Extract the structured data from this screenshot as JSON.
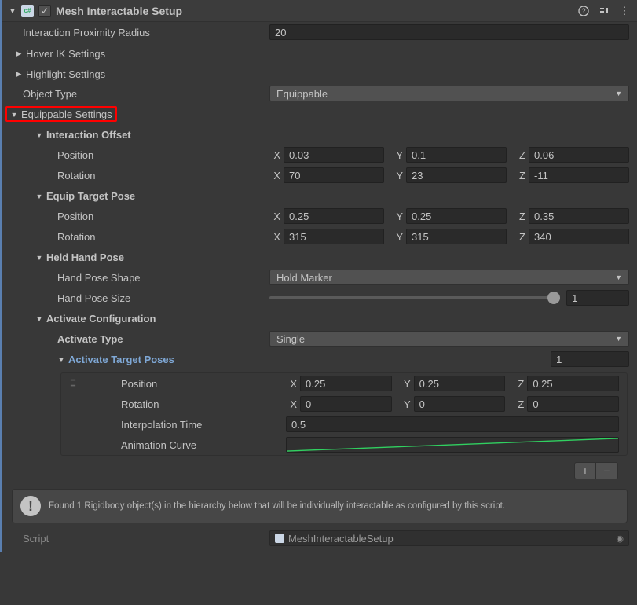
{
  "header": {
    "title": "Mesh Interactable Setup",
    "checked": true
  },
  "proximity": {
    "label": "Interaction Proximity Radius",
    "value": "20"
  },
  "hoverIK": {
    "label": "Hover IK Settings"
  },
  "highlight": {
    "label": "Highlight Settings"
  },
  "objectType": {
    "label": "Object Type",
    "value": "Equippable"
  },
  "equippable": {
    "label": "Equippable Settings",
    "interactionOffset": {
      "label": "Interaction Offset",
      "position": {
        "label": "Position",
        "x": "0.03",
        "y": "0.1",
        "z": "0.06"
      },
      "rotation": {
        "label": "Rotation",
        "x": "70",
        "y": "23",
        "z": "-11"
      }
    },
    "equipTargetPose": {
      "label": "Equip Target Pose",
      "position": {
        "label": "Position",
        "x": "0.25",
        "y": "0.25",
        "z": "0.35"
      },
      "rotation": {
        "label": "Rotation",
        "x": "315",
        "y": "315",
        "z": "340"
      }
    },
    "heldHandPose": {
      "label": "Held Hand Pose",
      "shape": {
        "label": "Hand Pose Shape",
        "value": "Hold Marker"
      },
      "size": {
        "label": "Hand Pose Size",
        "value": "1"
      }
    },
    "activateConfig": {
      "label": "Activate Configuration",
      "activateType": {
        "label": "Activate Type",
        "value": "Single"
      },
      "activateTargetPoses": {
        "label": "Activate Target Poses",
        "count": "1",
        "item0": {
          "position": {
            "label": "Position",
            "x": "0.25",
            "y": "0.25",
            "z": "0.25"
          },
          "rotation": {
            "label": "Rotation",
            "x": "0",
            "y": "0",
            "z": "0"
          },
          "interpTime": {
            "label": "Interpolation Time",
            "value": "0.5"
          },
          "animCurve": {
            "label": "Animation Curve"
          }
        }
      }
    }
  },
  "info": "Found 1 Rigidbody object(s) in the hierarchy below that will be individually interactable as configured by this script.",
  "script": {
    "label": "Script",
    "value": "MeshInteractableSetup"
  },
  "axes": {
    "x": "X",
    "y": "Y",
    "z": "Z"
  }
}
